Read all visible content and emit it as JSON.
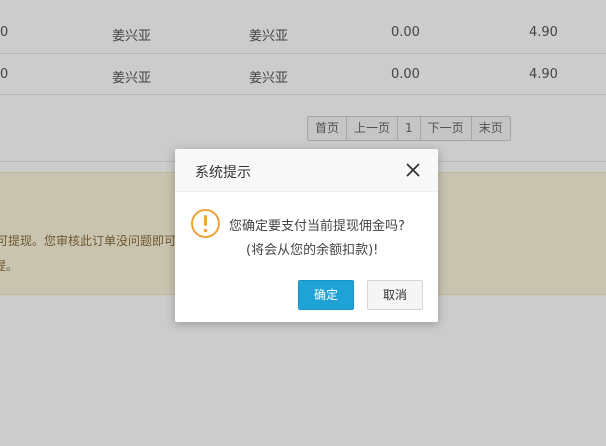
{
  "table": {
    "rows": [
      {
        "c0": "0",
        "c1": "姜兴亚",
        "c2": "姜兴亚",
        "c3": "0.00",
        "c4": "4.90"
      },
      {
        "c0": "0",
        "c1": "姜兴亚",
        "c2": "姜兴亚",
        "c3": "0.00",
        "c4": "4.90"
      }
    ]
  },
  "pager": {
    "first": "首页",
    "prev": "上一页",
    "current": "1",
    "next": "下一页",
    "last": "末页"
  },
  "notice": {
    "line1": "可提现。您审核此订单没问题即可提",
    "line2": "提。"
  },
  "dialog": {
    "title": "系统提示",
    "close_icon": "close-icon",
    "icon": "warning-icon",
    "message_line1": "您确定要支付当前提现佣金吗?",
    "message_line2": "(将会从您的余额扣款)!",
    "ok_label": "确定",
    "cancel_label": "取消",
    "colors": {
      "ok_button": "#1fa3d6",
      "warning_icon": "#f0a23b",
      "notice_bg": "#fcf6dc",
      "overlay": "rgba(0,0,0,0.2)"
    }
  }
}
